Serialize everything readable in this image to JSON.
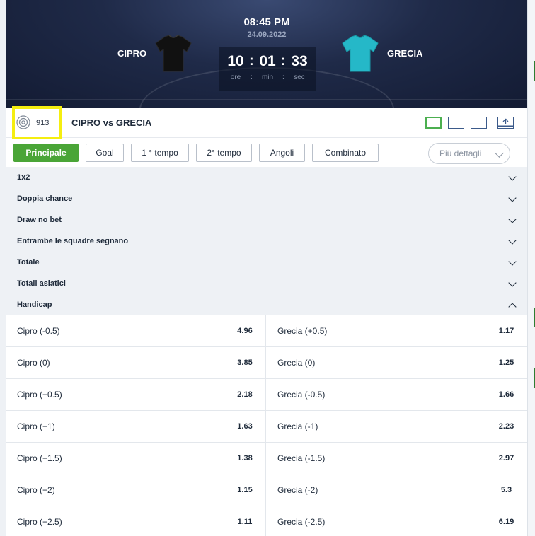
{
  "match": {
    "time": "08:45 PM",
    "date": "24.09.2022",
    "home_team": "CIPRO",
    "away_team": "GRECIA",
    "home_shirt_color": "#111111",
    "away_shirt_color": "#25b8c8",
    "countdown": {
      "hours": "10",
      "minutes": "01",
      "seconds": "33",
      "hours_label": "ore",
      "minutes_label": "min",
      "seconds_label": "sec",
      "separator": ":"
    }
  },
  "event": {
    "id": "913",
    "title": "CIPRO vs GRECIA"
  },
  "tabs": [
    {
      "label": "Principale",
      "active": true
    },
    {
      "label": "Goal",
      "active": false
    },
    {
      "label": "1 ° tempo",
      "active": false
    },
    {
      "label": "2° tempo",
      "active": false
    },
    {
      "label": "Angoli",
      "active": false
    },
    {
      "label": "Combinato",
      "active": false
    }
  ],
  "more_details": "Più dettagli",
  "markets": [
    {
      "label": "1x2",
      "expanded": false
    },
    {
      "label": "Doppia chance",
      "expanded": false
    },
    {
      "label": "Draw no bet",
      "expanded": false
    },
    {
      "label": "Entrambe le squadre segnano",
      "expanded": false
    },
    {
      "label": "Totale",
      "expanded": false
    },
    {
      "label": "Totali asiatici",
      "expanded": false
    },
    {
      "label": "Handicap",
      "expanded": true
    }
  ],
  "handicap": [
    {
      "home": "Cipro (-0.5)",
      "home_odd": "4.96",
      "away": "Grecia (+0.5)",
      "away_odd": "1.17"
    },
    {
      "home": "Cipro (0)",
      "home_odd": "3.85",
      "away": "Grecia (0)",
      "away_odd": "1.25"
    },
    {
      "home": "Cipro (+0.5)",
      "home_odd": "2.18",
      "away": "Grecia (-0.5)",
      "away_odd": "1.66"
    },
    {
      "home": "Cipro (+1)",
      "home_odd": "1.63",
      "away": "Grecia (-1)",
      "away_odd": "2.23"
    },
    {
      "home": "Cipro (+1.5)",
      "home_odd": "1.38",
      "away": "Grecia (-1.5)",
      "away_odd": "2.97"
    },
    {
      "home": "Cipro (+2)",
      "home_odd": "1.15",
      "away": "Grecia (-2)",
      "away_odd": "5.3"
    },
    {
      "home": "Cipro (+2.5)",
      "home_odd": "1.11",
      "away": "Grecia (-2.5)",
      "away_odd": "6.19"
    }
  ],
  "colors": {
    "accent_green": "#4aa537",
    "highlight_yellow": "#f5ee10"
  }
}
